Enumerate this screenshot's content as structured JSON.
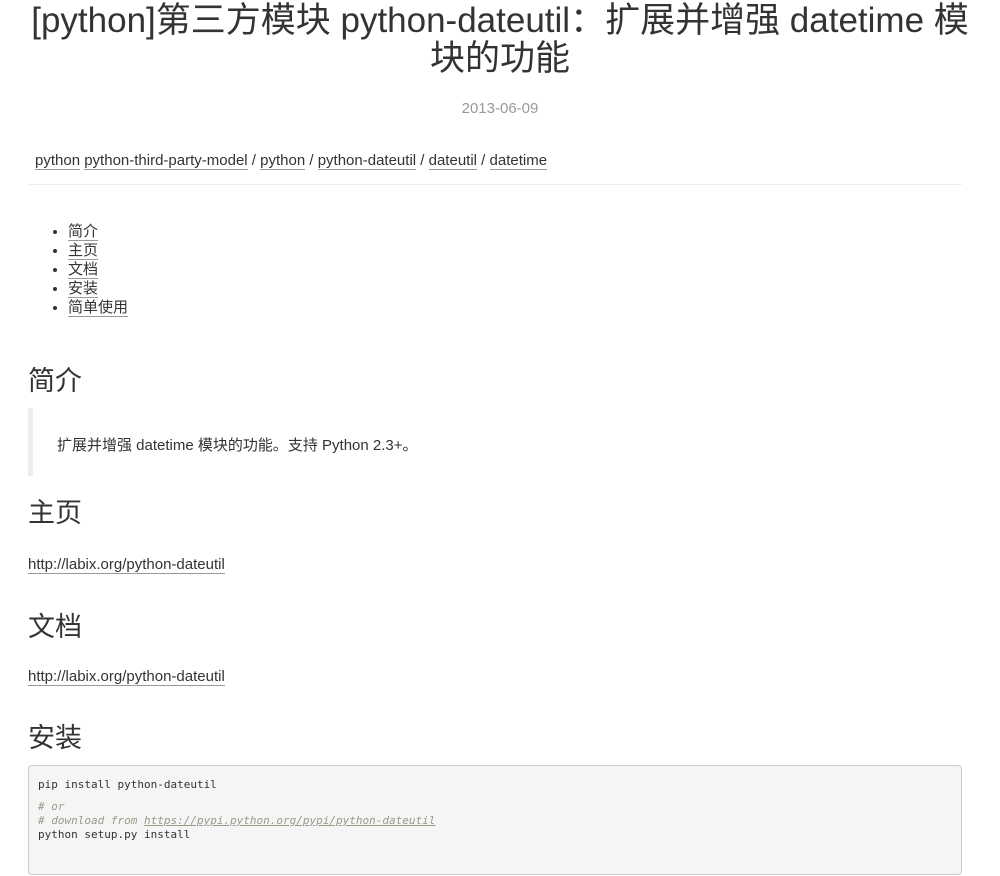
{
  "post": {
    "title": "[python]第三方模块 python-dateutil：扩展并增强 datetime 模块的功能",
    "date": "2013-06-09"
  },
  "tags": {
    "items": [
      "python",
      "python-third-party-model",
      "python",
      "python-dateutil",
      "dateutil",
      "datetime"
    ],
    "separator": " / "
  },
  "toc": {
    "items": [
      "简介",
      "主页",
      "文档",
      "安装",
      "简单使用"
    ]
  },
  "sections": {
    "intro": {
      "heading": "简介",
      "quote": "扩展并增强 datetime 模块的功能。支持 Python 2.3+。"
    },
    "homepage": {
      "heading": "主页",
      "link": "http://labix.org/python-dateutil"
    },
    "docs": {
      "heading": "文档",
      "link": "http://labix.org/python-dateutil"
    },
    "install": {
      "heading": "安装",
      "code": {
        "line1": "pip install python-dateutil",
        "comment1": "# or",
        "comment2_prefix": "# download from ",
        "comment2_url": "https://pypi.python.org/pypi/python-dateutil",
        "line4": "python setup.py install"
      }
    }
  }
}
